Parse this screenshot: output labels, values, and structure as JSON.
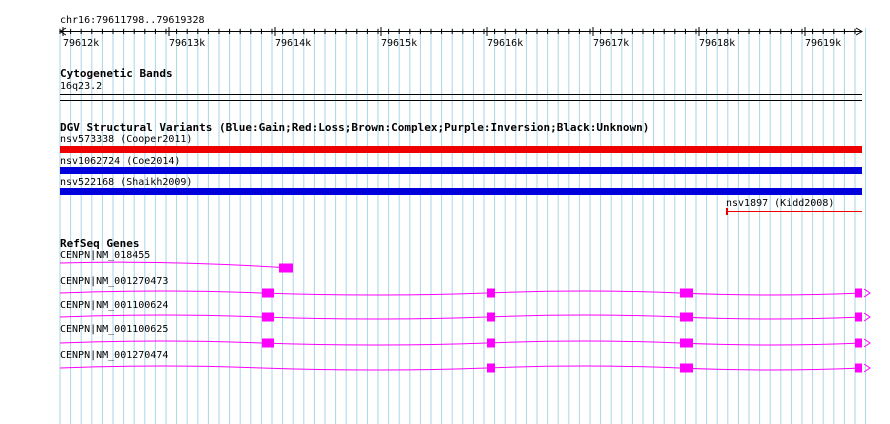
{
  "ruler": {
    "location": "chr16:79611798..79619328",
    "ticks": [
      "79612k",
      "79613k",
      "79614k",
      "79615k",
      "79616k",
      "79617k",
      "79618k",
      "79619k"
    ]
  },
  "tracks": {
    "cytoband": {
      "title": "Cytogenetic Bands",
      "band": "16q23.2"
    },
    "dgv": {
      "title": "DGV Structural Variants (Blue:Gain;Red:Loss;Brown:Complex;Purple:Inversion;Black:Unknown)",
      "features": [
        {
          "label": "nsv573338 (Cooper2011)",
          "color": "#ee0000"
        },
        {
          "label": "nsv1062724 (Coe2014)",
          "color": "#0000dd"
        },
        {
          "label": "nsv522168 (Shaikh2009)",
          "color": "#0000dd"
        },
        {
          "label": "nsv1897 (Kidd2008)",
          "color": "#ee0000"
        }
      ]
    },
    "refseq": {
      "title": "RefSeq Genes",
      "color": "#ff00ff",
      "transcripts": [
        {
          "label": "CENPN|NM_018455"
        },
        {
          "label": "CENPN|NM_001270473"
        },
        {
          "label": "CENPN|NM_001100624"
        },
        {
          "label": "CENPN|NM_001100625"
        },
        {
          "label": "CENPN|NM_001270474"
        }
      ]
    }
  }
}
